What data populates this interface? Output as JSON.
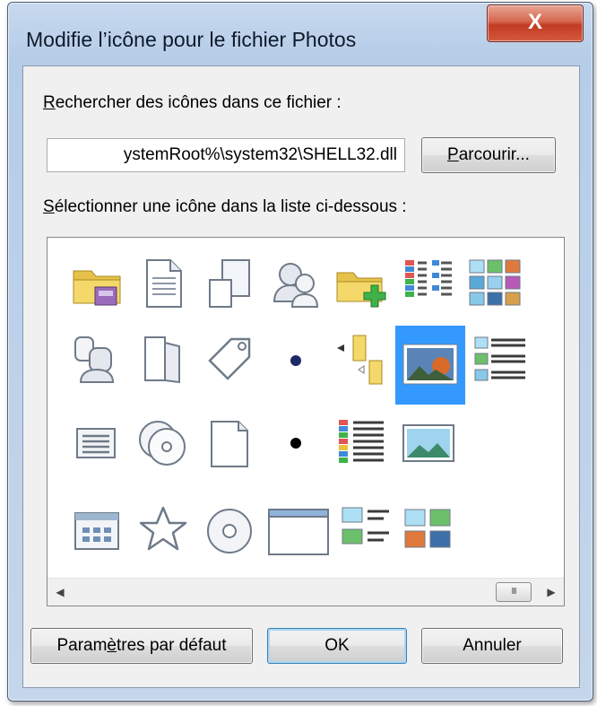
{
  "window": {
    "title": "Modifie l’icône pour le fichier Photos",
    "close_label": "X"
  },
  "search": {
    "label_prefix": "R",
    "label_rest": "echercher des icônes dans ce fichier :",
    "path_value": "ystemRoot%\\system32\\SHELL32.dll",
    "browse_prefix": "P",
    "browse_rest": "arcourir..."
  },
  "list": {
    "label_prefix": "S",
    "label_rest": "électionner une icône dans la liste ci-dessous :",
    "icons": [
      "drive-folder-icon",
      "document-icon",
      "resize-windows-icon",
      "users-icon",
      "folder-add-icon",
      "details-list-icon",
      "thumbnails-icon",
      "user-group-icon",
      "pages-icon",
      "tag-icon",
      "bullet-navy-icon",
      "folder-tree-icon",
      "photo-selected-icon",
      "list-view-icon",
      "text-lines-icon",
      "disks-icon",
      "blank-page-icon",
      "bullet-black-icon",
      "color-list-icon",
      "landscape-icon",
      "calendar-icon",
      "star-icon",
      "cd-icon",
      "window-icon",
      "image-list-icon",
      "image-grid-icon"
    ],
    "selected_icon": "photo-selected-icon",
    "scroll_thumb": "III"
  },
  "buttons": {
    "defaults_prefix": "Param",
    "defaults_u": "è",
    "defaults_rest": "tres par défaut",
    "ok": "OK",
    "cancel": "Annuler"
  },
  "colors": {
    "selection": "#3399ff",
    "titlebar": "#b6cde8",
    "close": "#c23a22"
  }
}
